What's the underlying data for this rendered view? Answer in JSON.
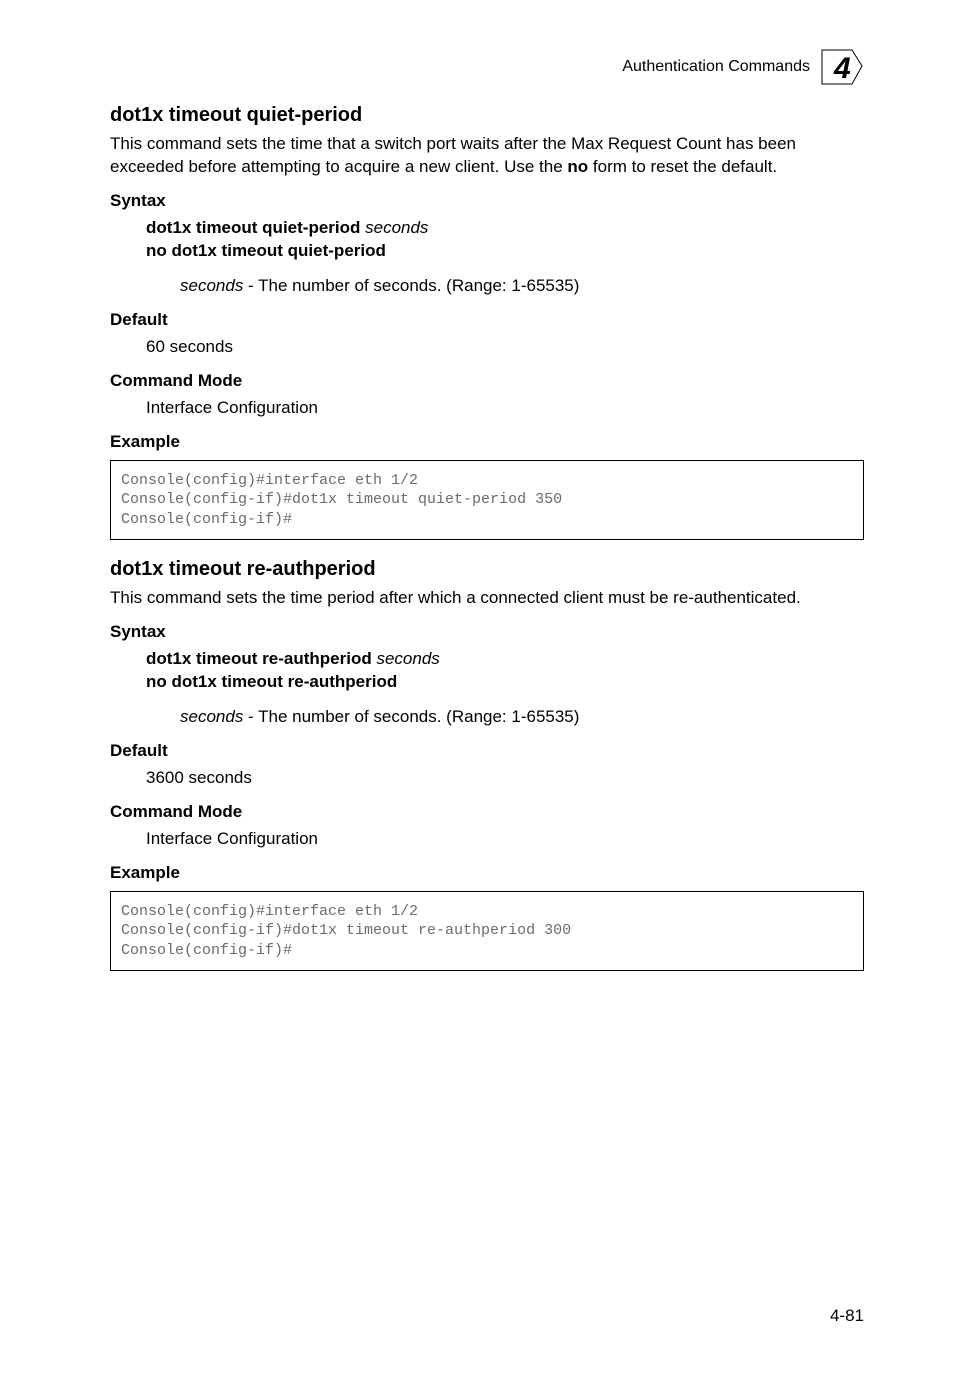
{
  "header": {
    "breadcrumb": "Authentication Commands",
    "chapter_number": "4"
  },
  "section1": {
    "title": "dot1x timeout quiet-period",
    "desc_part1": "This command sets the time that a switch port waits after the Max Request Count has been exceeded before attempting to acquire a new client. Use the ",
    "desc_no": "no",
    "desc_part2": " form to reset the default.",
    "syntax_label": "Syntax",
    "syntax_cmd_bold": "dot1x timeout quiet-period",
    "syntax_cmd_italic": " seconds",
    "syntax_no": "no dot1x timeout quiet-period",
    "param_italic": "seconds",
    "param_rest": " - The number of seconds. (Range: 1-65535)",
    "default_label": "Default",
    "default_value": "60 seconds",
    "mode_label": "Command Mode",
    "mode_value": "Interface Configuration",
    "example_label": "Example",
    "code": "Console(config)#interface eth 1/2\nConsole(config-if)#dot1x timeout quiet-period 350\nConsole(config-if)#"
  },
  "section2": {
    "title": "dot1x timeout re-authperiod",
    "desc": "This command sets the time period after which a connected client must be re-authenticated.",
    "syntax_label": "Syntax",
    "syntax_cmd_bold": "dot1x timeout re-authperiod",
    "syntax_cmd_italic": " seconds",
    "syntax_no": "no dot1x timeout re-authperiod",
    "param_italic": "seconds",
    "param_rest": " - The number of seconds. (Range: 1-65535)",
    "default_label": "Default",
    "default_value": "3600 seconds",
    "mode_label": "Command Mode",
    "mode_value": "Interface Configuration",
    "example_label": "Example",
    "code": "Console(config)#interface eth 1/2\nConsole(config-if)#dot1x timeout re-authperiod 300\nConsole(config-if)#"
  },
  "footer": {
    "page": "4-81"
  }
}
